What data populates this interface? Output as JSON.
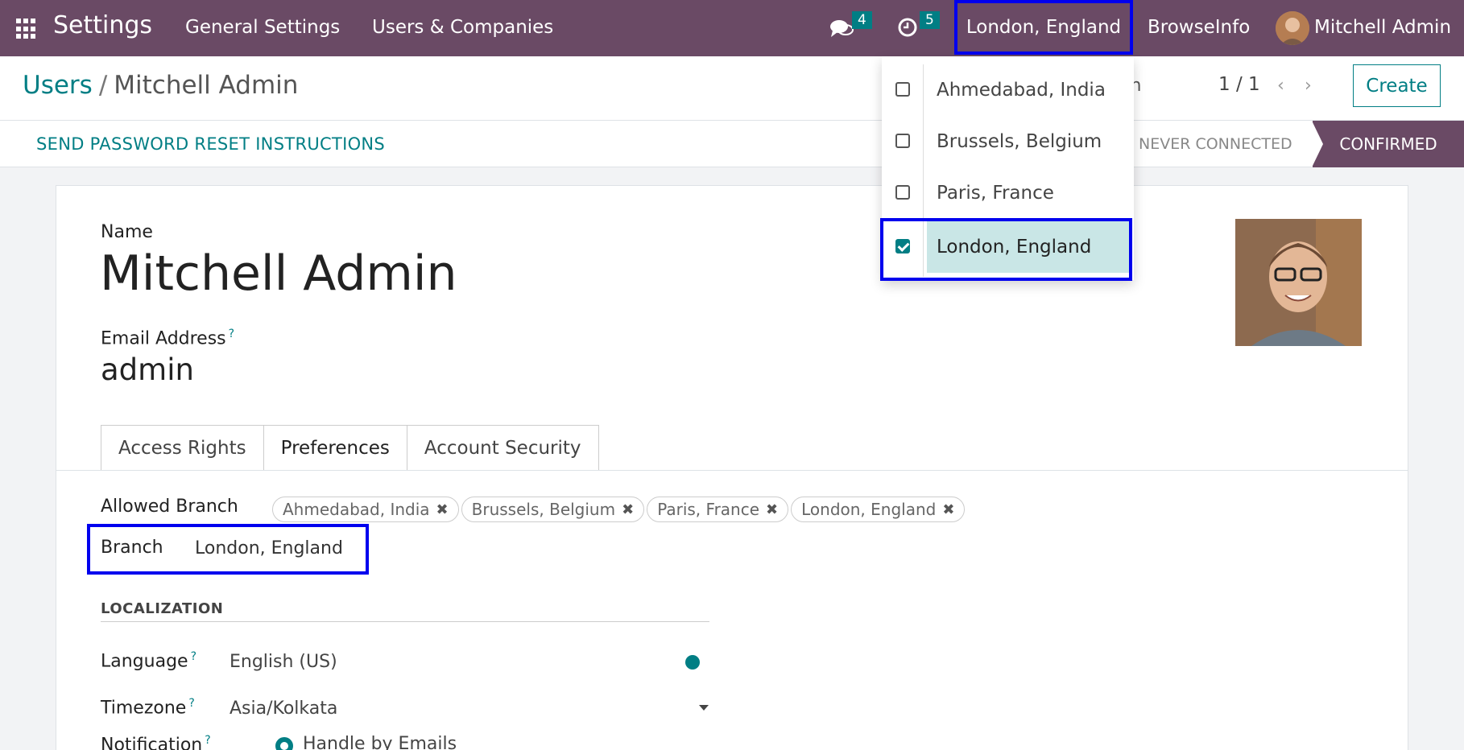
{
  "navbar": {
    "app_title": "Settings",
    "menus": [
      "General Settings",
      "Users & Companies"
    ],
    "messages_count": "4",
    "activities_count": "5",
    "current_branch": "London, England",
    "company": "BrowseInfo",
    "user": "Mitchell Admin",
    "accent_color": "#6a4a65"
  },
  "breadcrumb": {
    "parent": "Users",
    "separator": "/",
    "current": "Mitchell Admin"
  },
  "pager": {
    "partial_text": "on",
    "value": "1 / 1",
    "prev": "‹",
    "next": "›"
  },
  "toolbar": {
    "create_label": "Create"
  },
  "status": {
    "reset_label": "SEND PASSWORD RESET INSTRUCTIONS",
    "stages": [
      "NEVER CONNECTED",
      "CONFIRMED"
    ],
    "active_stage": "CONFIRMED"
  },
  "form": {
    "name_label": "Name",
    "name_value": "Mitchell Admin",
    "email_label": "Email Address",
    "email_value": "admin",
    "help_mark": "?",
    "tabs": [
      "Access Rights",
      "Preferences",
      "Account Security"
    ],
    "active_tab": "Preferences",
    "allowed_branch_label": "Allowed Branch",
    "allowed_branches": [
      "Ahmedabad, India",
      "Brussels, Belgium",
      "Paris, France",
      "London, England"
    ],
    "branch_label": "Branch",
    "branch_value": "London, England",
    "localization_title": "LOCALIZATION",
    "language_label": "Language",
    "language_value": "English (US)",
    "timezone_label": "Timezone",
    "timezone_value": "Asia/Kolkata",
    "notification_label": "Notification",
    "notification_value": "Handle by Emails"
  },
  "dropdown": {
    "items": [
      {
        "label": "Ahmedabad, India",
        "checked": false
      },
      {
        "label": "Brussels, Belgium",
        "checked": false
      },
      {
        "label": "Paris, France",
        "checked": false
      },
      {
        "label": "London, England",
        "checked": true
      }
    ]
  },
  "colors": {
    "primary": "#017e84",
    "highlight_box": "#0000ee",
    "selected_bg": "#c9e6e6"
  }
}
